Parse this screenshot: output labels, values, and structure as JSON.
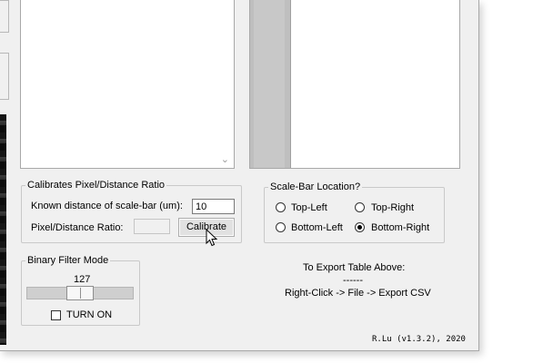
{
  "calibration": {
    "legend": "Calibrates Pixel/Distance Ratio",
    "known_distance_label": "Known distance of scale-bar (um):",
    "known_distance_value": "10",
    "ratio_label": "Pixel/Distance Ratio:",
    "ratio_value": "",
    "calibrate_button": "Calibrate"
  },
  "scale_bar": {
    "legend": "Scale-Bar Location?",
    "options": [
      {
        "label": "Top-Left",
        "checked": false
      },
      {
        "label": "Top-Right",
        "checked": false
      },
      {
        "label": "Bottom-Left",
        "checked": false
      },
      {
        "label": "Bottom-Right",
        "checked": true
      }
    ]
  },
  "binary_filter": {
    "legend": "Binary Filter Mode",
    "slider_value": "127",
    "slider_max": 255,
    "toggle_label": "TURN ON",
    "toggle_checked": false
  },
  "export_hint": {
    "line1": "To Export Table Above:",
    "line2": "------",
    "line3": "Right-Click -> File -> Export CSV"
  },
  "footer": "R.Lu (v1.3.2), 2020",
  "list_scroll_icon": "chevron-down-icon"
}
